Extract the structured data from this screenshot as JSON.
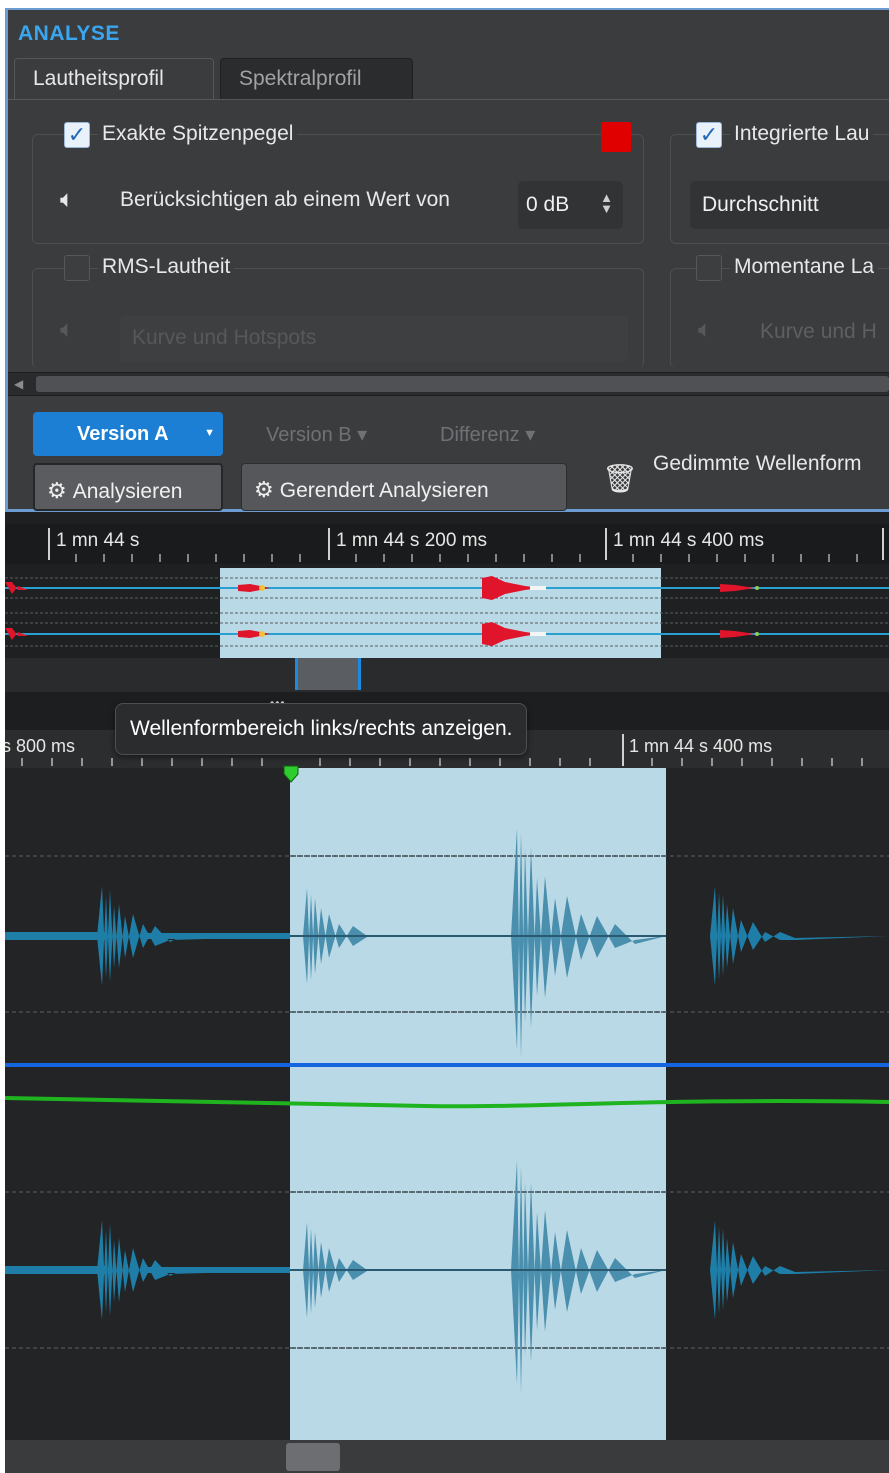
{
  "panel": {
    "title": "ANALYSE",
    "tabs": [
      "Lautheitsprofil",
      "Spektralprofil"
    ],
    "exakte": {
      "label": "Exakte Spitzenpegel",
      "checked": true,
      "swatch_color": "#e00000"
    },
    "threshold": {
      "label": "Berücksichtigen ab einem Wert von",
      "value": "0 dB"
    },
    "integrierte": {
      "label": "Integrierte Lau",
      "checked": true
    },
    "durchschnitt": "Durchschnitt",
    "rms": {
      "label": "RMS-Lautheit",
      "checked": false
    },
    "momentane": {
      "label": "Momentane La",
      "checked": false
    },
    "kurve_left": "Kurve und Hotspots",
    "kurve_right": "Kurve und H",
    "version_a": "Version A",
    "version_b": "Version B",
    "differenz": "Differenz",
    "analysieren": "Analysieren",
    "gerendert": "Gerendert Analysieren",
    "gedimmt": "Gedimmte Wellenform"
  },
  "overview_ruler": [
    "1 mn 44 s",
    "1 mn 44 s 200 ms",
    "1 mn 44 s 400 ms"
  ],
  "main_ruler": [
    "s 800 ms",
    "1 mn 44 s 400 ms"
  ],
  "tooltip": "Wellenformbereich links/rechts anzeigen.",
  "colors": {
    "accent": "#1c7fd4",
    "selection": "#bad9e6",
    "wave": "#1f7fa6",
    "blue_line": "#1565e0",
    "green_line": "#1fb41f"
  }
}
